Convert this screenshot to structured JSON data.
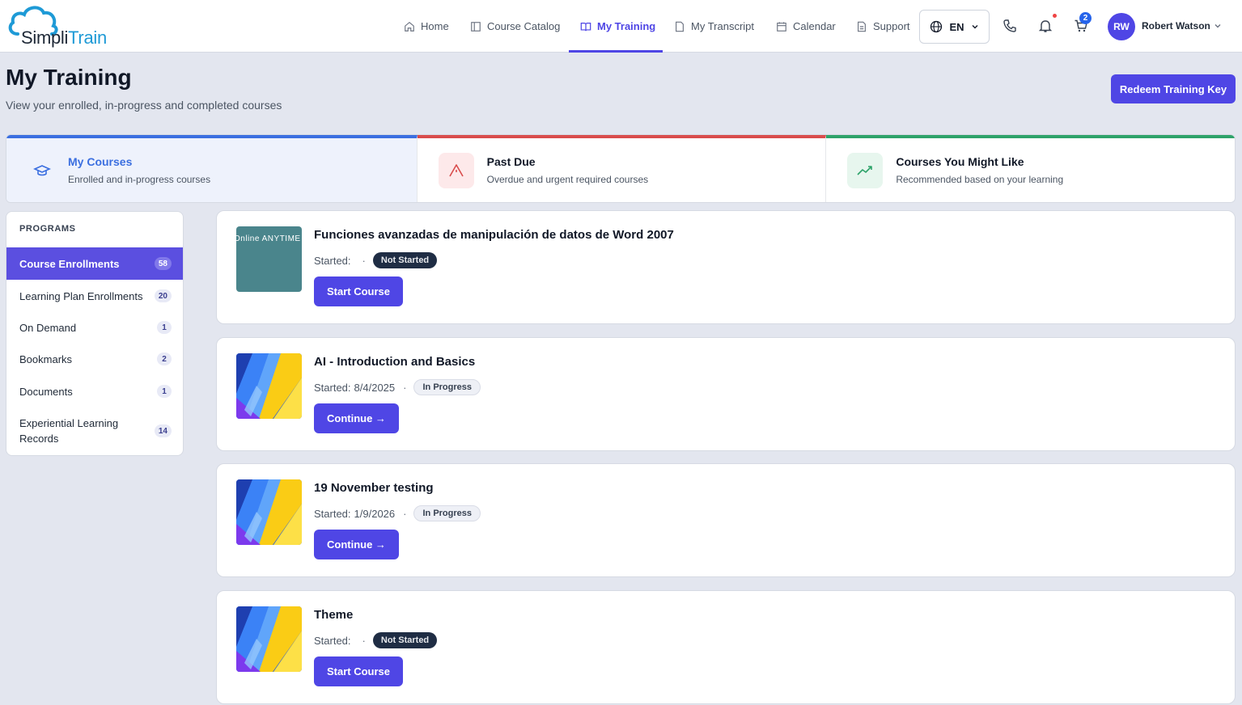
{
  "brand": {
    "name_part1": "Simpli",
    "name_part2": "Train"
  },
  "nav": {
    "items": [
      {
        "label": "Home",
        "icon": "home-icon"
      },
      {
        "label": "Course Catalog",
        "icon": "catalog-icon"
      },
      {
        "label": "My Training",
        "icon": "book-icon",
        "active": true
      },
      {
        "label": "My Transcript",
        "icon": "document-icon"
      },
      {
        "label": "Calendar",
        "icon": "calendar-icon"
      },
      {
        "label": "Support",
        "icon": "support-icon"
      }
    ],
    "language": "EN",
    "cart_count": "2",
    "user_initials": "RW",
    "user_name": "Robert Watson"
  },
  "page": {
    "title": "My Training",
    "subtitle": "View your enrolled, in-progress and completed courses",
    "redeem_label": "Redeem Training Key"
  },
  "tabs": [
    {
      "title": "My Courses",
      "desc": "Enrolled and in-progress courses",
      "icon": "graduation-cap-icon"
    },
    {
      "title": "Past Due",
      "desc": "Overdue and urgent required courses",
      "icon": "warning-icon"
    },
    {
      "title": "Courses You Might Like",
      "desc": "Recommended based on your learning",
      "icon": "trending-icon"
    }
  ],
  "sidebar": {
    "heading": "PROGRAMS",
    "items": [
      {
        "label": "Course Enrollments",
        "count": "58",
        "active": true
      },
      {
        "label": "Learning Plan Enrollments",
        "count": "20"
      },
      {
        "label": "On Demand",
        "count": "1"
      },
      {
        "label": "Bookmarks",
        "count": "2"
      },
      {
        "label": "Documents",
        "count": "1"
      },
      {
        "label": "Experiential Learning Records",
        "count": "14"
      }
    ]
  },
  "courses": [
    {
      "title": "Funciones avanzadas de manipulación de datos de Word 2007",
      "started_label": "Started:",
      "started_date": "",
      "status": "Not Started",
      "button": "Start Course",
      "thumb_text": "Online ANYTIME"
    },
    {
      "title": "AI - Introduction and Basics",
      "started_label": "Started:",
      "started_date": "8/4/2025",
      "status": "In Progress",
      "button": "Continue →"
    },
    {
      "title": "19 November testing",
      "started_label": "Started:",
      "started_date": "1/9/2026",
      "status": "In Progress",
      "button": "Continue →"
    },
    {
      "title": "Theme",
      "started_label": "Started:",
      "started_date": "",
      "status": "Not Started",
      "button": "Start Course"
    }
  ],
  "colors": {
    "accent": "#4f46e5",
    "tab_blue": "#3b6fe0",
    "tab_red": "#d94c4c",
    "tab_green": "#2ea36a"
  }
}
